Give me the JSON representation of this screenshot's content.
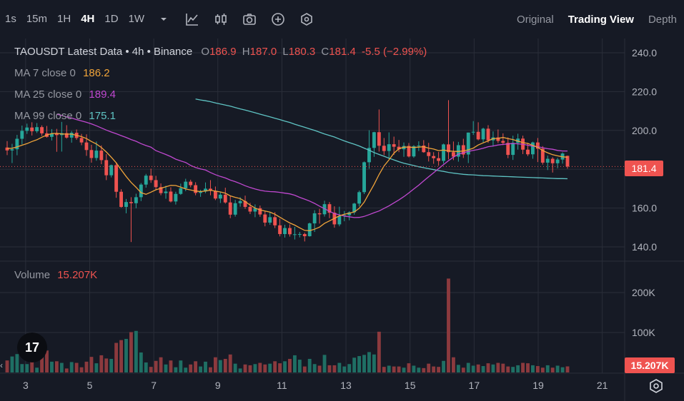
{
  "toolbar": {
    "timeframes": [
      "1s",
      "15m",
      "1H",
      "4H",
      "1D",
      "1W"
    ],
    "active_timeframe": "4H",
    "icons": [
      "dropdown-icon",
      "indicators-icon",
      "candle-type-icon",
      "screenshot-icon",
      "add-icon",
      "settings-hex-icon"
    ],
    "views": [
      "Original",
      "Trading View",
      "Depth"
    ],
    "active_view": "Trading View"
  },
  "legend": {
    "title": "TAOUSDT Latest Data • 4h • Binance",
    "o_label": "O",
    "o": "186.9",
    "h_label": "H",
    "h": "187.0",
    "l_label": "L",
    "l": "180.3",
    "c_label": "C",
    "c": "181.4",
    "change": "-5.5 (−2.99%)",
    "ma7_label": "MA 7 close 0",
    "ma7_value": "186.2",
    "ma25_label": "MA 25 close 0",
    "ma25_value": "189.4",
    "ma99_label": "MA 99 close 0",
    "ma99_value": "175.1",
    "volume_label": "Volume",
    "volume_value": "15.207K"
  },
  "price_tag": "181.4",
  "volume_tag": "15.207K",
  "logo_text": "17",
  "colors": {
    "background": "#161a25",
    "up": "#26a69a",
    "down": "#ef5350",
    "ma7": "#f0a43a",
    "ma25": "#c048d0",
    "ma99": "#5fc4c4",
    "grid": "#2a2e39"
  },
  "chart_data": {
    "type": "candlestick",
    "title": "TAOUSDT Latest Data • 4h • Binance",
    "interval": "4h",
    "price_axis": {
      "ticks": [
        140,
        160,
        180,
        200,
        220,
        240
      ],
      "range": [
        133,
        254
      ]
    },
    "volume_axis": {
      "ticks": [
        "100K",
        "200K"
      ],
      "range": [
        0,
        260000
      ]
    },
    "x_axis": {
      "ticks": [
        "3",
        "5",
        "7",
        "9",
        "11",
        "13",
        "15",
        "17",
        "19",
        "21"
      ],
      "start_day": 2.2,
      "end_day": 21.7
    },
    "last_price": 181.4,
    "candles": [
      [
        191.2,
        194.5,
        187.3,
        189.7,
        30000
      ],
      [
        189.7,
        193.1,
        183.2,
        190.3,
        40000
      ],
      [
        190.3,
        197.7,
        187.2,
        195.7,
        46000
      ],
      [
        195.7,
        202.5,
        192.8,
        199.8,
        21000
      ],
      [
        199.8,
        203.5,
        198.2,
        201.5,
        21000
      ],
      [
        201.5,
        204.2,
        197.4,
        199.6,
        36000
      ],
      [
        199.6,
        203.8,
        198.7,
        201.7,
        12000
      ],
      [
        201.7,
        202.6,
        197.2,
        198.5,
        46000
      ],
      [
        198.5,
        202.3,
        196.3,
        196.7,
        55000
      ],
      [
        196.7,
        200.7,
        194.8,
        198.4,
        27000
      ],
      [
        198.4,
        200.8,
        189.0,
        197.6,
        28000
      ],
      [
        197.6,
        204.4,
        189.1,
        198.6,
        24000
      ],
      [
        198.6,
        202.7,
        195.8,
        196.3,
        10000
      ],
      [
        196.3,
        199.7,
        193.7,
        198.8,
        26000
      ],
      [
        198.8,
        200.5,
        195.2,
        196.1,
        24000
      ],
      [
        196.1,
        198.2,
        192.4,
        193.8,
        13000
      ],
      [
        193.8,
        198.0,
        186.9,
        189.9,
        27000
      ],
      [
        189.9,
        192.6,
        183.4,
        185.8,
        39000
      ],
      [
        185.8,
        194.3,
        184.4,
        189.6,
        23000
      ],
      [
        189.6,
        192.3,
        182.6,
        184.7,
        43000
      ],
      [
        184.7,
        187.8,
        174.4,
        176.9,
        35000
      ],
      [
        176.9,
        182.4,
        175.8,
        182.1,
        34000
      ],
      [
        182.1,
        183.6,
        165.3,
        168.4,
        74000
      ],
      [
        168.4,
        169.7,
        160.2,
        160.6,
        81000
      ],
      [
        160.6,
        164.7,
        157.3,
        163.1,
        84000
      ],
      [
        163.1,
        165.6,
        142.5,
        162.5,
        101000
      ],
      [
        162.5,
        167.4,
        159.9,
        165.6,
        104000
      ],
      [
        165.6,
        172.9,
        163.6,
        172.1,
        50000
      ],
      [
        172.1,
        177.6,
        170.5,
        176.7,
        25000
      ],
      [
        176.7,
        180.3,
        173.0,
        174.4,
        14000
      ],
      [
        174.4,
        176.6,
        169.2,
        170.8,
        29000
      ],
      [
        170.8,
        172.7,
        166.6,
        167.7,
        38000
      ],
      [
        167.7,
        171.5,
        164.8,
        168.5,
        20000
      ],
      [
        168.5,
        170.7,
        162.9,
        163.4,
        30000
      ],
      [
        163.4,
        168.4,
        161.8,
        167.3,
        13000
      ],
      [
        167.3,
        172.6,
        166.8,
        170.2,
        30000
      ],
      [
        170.2,
        175.1,
        168.7,
        173.6,
        12000
      ],
      [
        173.6,
        174.6,
        170.7,
        171.8,
        20000
      ],
      [
        171.8,
        173.3,
        166.6,
        167.8,
        28000
      ],
      [
        167.8,
        169.4,
        165.8,
        168.6,
        15000
      ],
      [
        168.6,
        173.2,
        167.7,
        170.0,
        27000
      ],
      [
        170.0,
        174.4,
        166.6,
        168.9,
        13000
      ],
      [
        168.9,
        171.1,
        164.1,
        164.9,
        38000
      ],
      [
        164.9,
        168.3,
        162.6,
        166.9,
        31000
      ],
      [
        166.9,
        170.5,
        162.3,
        162.9,
        34000
      ],
      [
        162.9,
        166.2,
        154.8,
        156.6,
        45000
      ],
      [
        156.6,
        164.2,
        155.6,
        162.5,
        22000
      ],
      [
        162.5,
        165.6,
        160.7,
        163.6,
        10000
      ],
      [
        163.6,
        166.4,
        159.6,
        160.6,
        20000
      ],
      [
        160.6,
        162.7,
        156.9,
        158.2,
        18000
      ],
      [
        158.2,
        161.9,
        155.3,
        159.9,
        21000
      ],
      [
        159.9,
        161.3,
        155.5,
        156.7,
        24000
      ],
      [
        156.7,
        158.3,
        150.6,
        152.5,
        20000
      ],
      [
        152.5,
        157.8,
        151.4,
        155.3,
        22000
      ],
      [
        155.3,
        157.9,
        149.7,
        151.1,
        28000
      ],
      [
        151.1,
        154.5,
        145.4,
        146.6,
        23000
      ],
      [
        146.6,
        151.4,
        144.8,
        149.7,
        28000
      ],
      [
        149.7,
        151.6,
        145.3,
        146.5,
        34000
      ],
      [
        146.5,
        150.3,
        143.8,
        146.5,
        43000
      ],
      [
        146.5,
        147.7,
        144.9,
        146.6,
        32000
      ],
      [
        146.6,
        147.3,
        142.8,
        145.5,
        15000
      ],
      [
        145.5,
        152.5,
        145.3,
        152.1,
        34000
      ],
      [
        152.1,
        158.9,
        147.7,
        157.3,
        21000
      ],
      [
        157.3,
        159.6,
        152.0,
        156.8,
        17000
      ],
      [
        156.8,
        163.8,
        155.6,
        162.0,
        44000
      ],
      [
        162.0,
        163.1,
        154.8,
        157.6,
        18000
      ],
      [
        157.6,
        160.9,
        149.9,
        151.6,
        18000
      ],
      [
        151.6,
        160.7,
        150.6,
        155.9,
        24000
      ],
      [
        155.9,
        158.5,
        153.2,
        156.3,
        15000
      ],
      [
        156.3,
        158.4,
        153.7,
        157.8,
        21000
      ],
      [
        157.8,
        162.7,
        156.6,
        162.3,
        37000
      ],
      [
        162.3,
        169.0,
        160.8,
        168.2,
        41000
      ],
      [
        168.2,
        184.0,
        167.2,
        183.6,
        44000
      ],
      [
        183.6,
        200.1,
        180.3,
        191.0,
        51000
      ],
      [
        191.0,
        199.3,
        186.4,
        199.1,
        45000
      ],
      [
        199.1,
        210.8,
        189.1,
        192.1,
        102000
      ],
      [
        192.1,
        196.1,
        187.3,
        189.4,
        14000
      ],
      [
        189.4,
        199.0,
        185.2,
        192.9,
        17000
      ],
      [
        192.9,
        196.8,
        187.4,
        191.6,
        15000
      ],
      [
        191.6,
        195.1,
        188.8,
        190.3,
        15000
      ],
      [
        190.3,
        193.8,
        186.4,
        192.0,
        12000
      ],
      [
        192.0,
        193.5,
        186.1,
        186.6,
        23000
      ],
      [
        186.6,
        192.4,
        185.9,
        191.9,
        17000
      ],
      [
        191.9,
        194.4,
        189.4,
        192.2,
        12000
      ],
      [
        192.2,
        195.0,
        188.5,
        188.8,
        11000
      ],
      [
        188.8,
        193.6,
        184.0,
        186.8,
        22000
      ],
      [
        186.8,
        188.8,
        182.8,
        185.7,
        15000
      ],
      [
        185.7,
        188.9,
        181.8,
        184.3,
        14000
      ],
      [
        184.3,
        193.2,
        182.9,
        192.8,
        29000
      ],
      [
        192.8,
        215.6,
        185.1,
        188.8,
        235000
      ],
      [
        188.8,
        194.3,
        184.7,
        186.5,
        38000
      ],
      [
        186.5,
        194.1,
        183.9,
        192.4,
        19000
      ],
      [
        192.4,
        195.7,
        185.8,
        187.6,
        12000
      ],
      [
        187.6,
        198.9,
        183.2,
        198.9,
        24000
      ],
      [
        198.9,
        204.8,
        197.7,
        199.3,
        17000
      ],
      [
        199.3,
        204.2,
        194.9,
        195.4,
        20000
      ],
      [
        195.4,
        201.4,
        193.8,
        200.9,
        16000
      ],
      [
        200.9,
        202.7,
        193.6,
        194.9,
        23000
      ],
      [
        194.9,
        199.5,
        191.7,
        196.4,
        20000
      ],
      [
        196.4,
        200.5,
        193.5,
        194.6,
        24000
      ],
      [
        194.6,
        198.5,
        192.4,
        193.6,
        22000
      ],
      [
        193.6,
        196.4,
        185.7,
        187.4,
        15000
      ],
      [
        187.4,
        197.3,
        184.8,
        193.6,
        14000
      ],
      [
        193.6,
        198.3,
        190.1,
        195.8,
        18000
      ],
      [
        195.8,
        197.3,
        187.8,
        190.1,
        24000
      ],
      [
        190.1,
        193.6,
        186.8,
        187.7,
        23000
      ],
      [
        187.7,
        194.2,
        185.4,
        193.8,
        18000
      ],
      [
        193.8,
        196.1,
        183.7,
        190.6,
        16000
      ],
      [
        190.6,
        191.9,
        182.4,
        183.4,
        12000
      ],
      [
        183.4,
        187.0,
        179.6,
        185.4,
        18000
      ],
      [
        185.4,
        186.2,
        178.3,
        183.1,
        12000
      ],
      [
        183.1,
        185.9,
        180.5,
        185.0,
        17000
      ],
      [
        185.0,
        188.7,
        182.9,
        188.1,
        13000
      ],
      [
        186.9,
        187.0,
        180.3,
        181.4,
        15207
      ]
    ],
    "ma7": [
      190.7,
      190.8,
      191.5,
      192.4,
      193.2,
      194.3,
      195.2,
      196.5,
      197.6,
      198.4,
      198.5,
      198.2,
      198.1,
      198.1,
      197.5,
      196.8,
      195.8,
      194.3,
      193.0,
      191.2,
      188.9,
      186.2,
      183.3,
      179.7,
      176.3,
      173.2,
      170.7,
      167.9,
      167.1,
      168.2,
      169.4,
      170.2,
      171.0,
      171.7,
      171.6,
      170.8,
      169.8,
      169.3,
      168.8,
      168.5,
      168.8,
      169.2,
      168.7,
      168.3,
      167.7,
      166.3,
      165.5,
      164.9,
      163.4,
      161.5,
      160.0,
      159.0,
      158.5,
      157.9,
      156.8,
      155.3,
      153.8,
      152.3,
      151.2,
      149.8,
      148.5,
      148.3,
      149.1,
      150.2,
      152.1,
      153.4,
      154.7,
      156.0,
      156.8,
      157.4,
      158.0,
      159.9,
      163.0,
      167.7,
      172.2,
      177.3,
      181.7,
      184.8,
      188.3,
      190.5,
      191.4,
      191.4,
      191.2,
      191.4,
      191.6,
      190.9,
      190.4,
      189.6,
      189.9,
      189.5,
      189.2,
      189.2,
      189.4,
      190.0,
      190.9,
      192.5,
      193.6,
      194.6,
      195.8,
      195.9,
      196.4,
      195.8,
      195.3,
      194.5,
      193.7,
      193.3,
      192.3,
      191.3,
      189.6,
      188.5,
      187.5,
      186.9,
      186.4,
      186.2
    ],
    "ma25": [
      208.4,
      207.7,
      207.0,
      206.4,
      205.6,
      204.9,
      204.2,
      203.4,
      202.4,
      201.3,
      200.2,
      199.2,
      198.3,
      197.3,
      196.4,
      195.3,
      194.4,
      193.2,
      192.2,
      191.4,
      189.6,
      188.6,
      187.6,
      186.5,
      185.2,
      184.3,
      183.5,
      182.0,
      180.9,
      180.2,
      179.6,
      178.3,
      177.2,
      176.3,
      175.5,
      174.4,
      173.6,
      172.6,
      171.5,
      170.6,
      169.8,
      169.2,
      168.7,
      168.5,
      168.4,
      168.1,
      167.7,
      167.3,
      166.6,
      165.5,
      164.6,
      163.6,
      162.4,
      161.0,
      159.7,
      158.3,
      157.2,
      156.5,
      155.9,
      155.5,
      155.1,
      155.2,
      155.7,
      156.6,
      157.6,
      158.5,
      159.8,
      161.1,
      162.7,
      164.2,
      165.9,
      167.8,
      169.8,
      171.8,
      174.0,
      176.1,
      178.2,
      180.3,
      182.4,
      184.4,
      186.2,
      187.8,
      188.5,
      189.2,
      189.7,
      190.2,
      190.8,
      191.6,
      192.0,
      192.5,
      192.8,
      193.0,
      193.3,
      193.1,
      192.9,
      192.4,
      191.9,
      191.6,
      191.1,
      190.6,
      190.3,
      189.7,
      189.4,
      189.4
    ],
    "ma99": [
      216.2,
      215.7,
      215.3,
      214.8,
      214.2,
      213.6,
      213.1,
      212.5,
      211.8,
      211.1,
      210.5,
      209.8,
      209.1,
      208.4,
      207.7,
      207.0,
      206.3,
      205.6,
      204.8,
      204.1,
      203.2,
      202.4,
      201.6,
      200.8,
      200.0,
      199.1,
      198.2,
      197.4,
      196.6,
      195.6,
      194.6,
      193.7,
      192.9,
      192.0,
      190.9,
      189.8,
      188.6,
      187.6,
      186.7,
      185.7,
      184.8,
      183.9,
      183.1,
      182.5,
      181.9,
      181.3,
      180.8,
      180.3,
      179.8,
      179.3,
      178.9,
      178.4,
      178.0,
      177.7,
      177.4,
      177.2,
      177.1,
      176.9,
      176.7,
      176.6,
      176.5,
      176.4,
      176.3,
      176.2,
      176.1,
      176.0,
      175.9,
      175.8,
      175.7,
      175.6,
      175.5,
      175.4,
      175.3,
      175.2,
      175.2,
      175.1
    ]
  }
}
